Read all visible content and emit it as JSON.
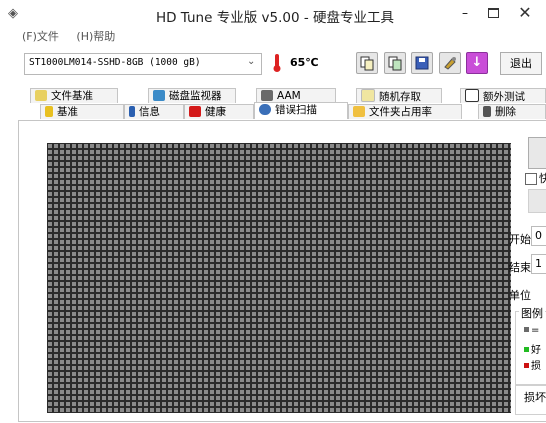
{
  "window": {
    "title": "HD Tune 专业版 v5.00 - 硬盘专业工具",
    "minimize": "–",
    "close": "✕"
  },
  "menu": {
    "items": [
      "(F)文件",
      "(H)帮助"
    ]
  },
  "toolbar": {
    "drive": "ST1000LM014-SSHD-8GB (1000 gB)",
    "temperature": "65℃",
    "exit_label": "退出",
    "button_icons": [
      "copy-text-icon",
      "copy-image-icon",
      "save-icon",
      "options-icon",
      "download-icon"
    ]
  },
  "tabs": {
    "row1": [
      "文件基准",
      "磁盘监视器",
      "AAM",
      "随机存取",
      "额外测试"
    ],
    "row2": [
      "基准",
      "信息",
      "健康",
      "错误扫描",
      "文件夹占用率",
      "删除"
    ],
    "selected": "错误扫描"
  },
  "errorscan": {
    "quick_scan_label": "快",
    "start_label": "开始",
    "start_value": "0",
    "end_label": "结束",
    "end_value": "1",
    "unit_label": "单位",
    "legend_title": "图例",
    "legend_items": [
      "=",
      "好",
      "损"
    ],
    "damage_label": "损坏"
  },
  "colors": {
    "grid_block": "#8a8a8a",
    "grid_line": "#2a2a2a",
    "good": "#22bb22",
    "bad": "#cc1111",
    "accent_purple": "#c94ed8"
  }
}
